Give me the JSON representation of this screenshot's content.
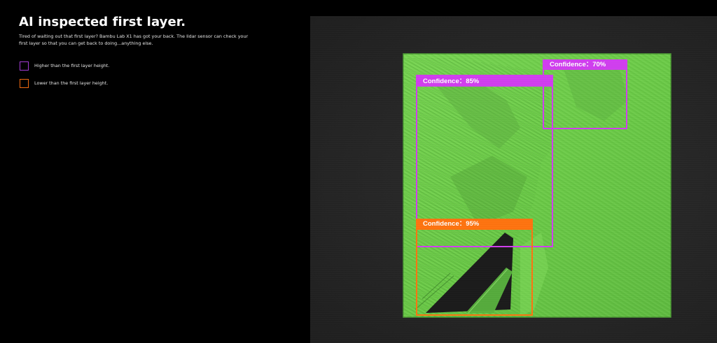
{
  "headline": "AI inspected first layer.",
  "description": "Tired of waiting out that first layer? Bambu Lab X1 has got your back. The lidar sensor can check your first layer so that you can get back to doing...anything else.",
  "legend": [
    {
      "label": "Higher than the first layer height.",
      "color": "#a23bd4"
    },
    {
      "label": "Lower than the first layer height.",
      "color": "#f06a10"
    }
  ],
  "detections": [
    {
      "label": "Confidence：85%",
      "kind": "higher",
      "color": "#d13ff0"
    },
    {
      "label": "Confidence：70%",
      "kind": "higher",
      "color": "#d13ff0"
    },
    {
      "label": "Confidence：95%",
      "kind": "lower",
      "color": "#ff7410"
    }
  ],
  "colors": {
    "background": "#000000",
    "photo_background": "#262626",
    "print_green": "#6fcf4b"
  }
}
